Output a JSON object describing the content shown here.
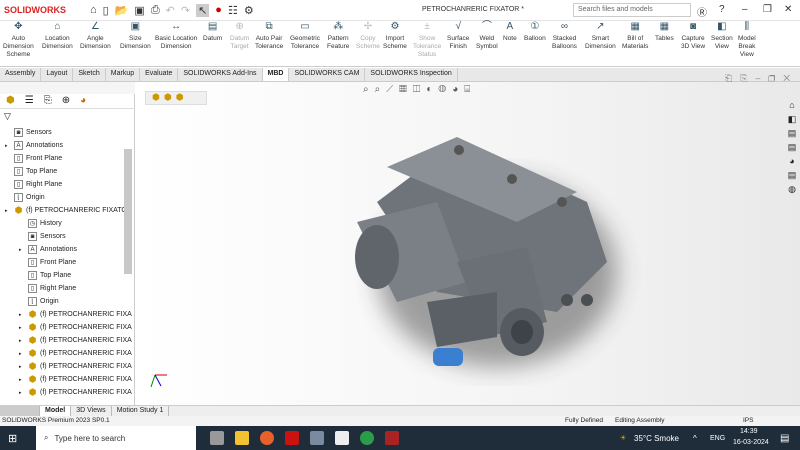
{
  "app": {
    "logo": "SOLIDWORKS",
    "title": "PETROCHANRERIC FIXATOR *",
    "search_placeholder": "Search files and models"
  },
  "ribbon": [
    {
      "label": "Auto\nDimension\nScheme",
      "icon": "✥",
      "enabled": true
    },
    {
      "label": "Location\nDimension",
      "icon": "⌂",
      "enabled": true
    },
    {
      "label": "Angle\nDimension",
      "icon": "∠",
      "enabled": true
    },
    {
      "label": "Size\nDimension",
      "icon": "▣",
      "enabled": true
    },
    {
      "label": "Basic Location\nDimension",
      "icon": "↔",
      "enabled": true
    },
    {
      "label": "Datum",
      "icon": "▤",
      "enabled": true
    },
    {
      "label": "Datum\nTarget",
      "icon": "⊕",
      "enabled": false
    },
    {
      "label": "Auto Pair\nTolerance",
      "icon": "⧉",
      "enabled": true
    },
    {
      "label": "Geometric\nTolerance",
      "icon": "▭",
      "enabled": true
    },
    {
      "label": "Pattern\nFeature",
      "icon": "⁂",
      "enabled": true
    },
    {
      "label": "Copy\nScheme",
      "icon": "✢",
      "enabled": false
    },
    {
      "label": "Import\nScheme",
      "icon": "⚙",
      "enabled": true
    },
    {
      "label": "Show\nTolerance\nStatus",
      "icon": "±",
      "enabled": false
    },
    {
      "label": "Surface\nFinish",
      "icon": "√",
      "enabled": true
    },
    {
      "label": "Weld\nSymbol",
      "icon": "⌒",
      "enabled": true
    },
    {
      "label": "Note",
      "icon": "A",
      "enabled": true
    },
    {
      "label": "Balloon",
      "icon": "①",
      "enabled": true
    },
    {
      "label": "Stacked\nBalloons",
      "icon": "∞",
      "enabled": true
    },
    {
      "label": "Smart\nDimension",
      "icon": "↗",
      "enabled": true
    },
    {
      "label": "Bill of\nMaterials",
      "icon": "▦",
      "enabled": true
    },
    {
      "label": "Tables",
      "icon": "▦",
      "enabled": true
    },
    {
      "label": "Capture\n3D View",
      "icon": "◙",
      "enabled": true
    },
    {
      "label": "Section\nView",
      "icon": "◧",
      "enabled": true
    },
    {
      "label": "Model\nBreak\nView",
      "icon": "⫼",
      "enabled": true
    }
  ],
  "tabs": [
    "Assembly",
    "Layout",
    "Sketch",
    "Markup",
    "Evaluate",
    "SOLIDWORKS Add-Ins",
    "MBD",
    "SOLIDWORKS CAM",
    "SOLIDWORKS Inspection"
  ],
  "active_tab": "MBD",
  "tree": [
    {
      "label": "Sensors",
      "icon": "sensor",
      "indent": 1,
      "expand": false
    },
    {
      "label": "Annotations",
      "icon": "A",
      "indent": 1,
      "expand": true
    },
    {
      "label": "Front Plane",
      "icon": "plane",
      "indent": 1,
      "expand": false
    },
    {
      "label": "Top Plane",
      "icon": "plane",
      "indent": 1,
      "expand": false
    },
    {
      "label": "Right Plane",
      "icon": "plane",
      "indent": 1,
      "expand": false
    },
    {
      "label": "Origin",
      "icon": "origin",
      "indent": 1,
      "expand": false
    },
    {
      "label": "(f) PETROCHANRERIC FIXATOR",
      "icon": "assembly",
      "indent": 1,
      "expand": true
    },
    {
      "label": "History",
      "icon": "history",
      "indent": 2,
      "expand": false
    },
    {
      "label": "Sensors",
      "icon": "sensor",
      "indent": 2,
      "expand": false
    },
    {
      "label": "Annotations",
      "icon": "A",
      "indent": 2,
      "expand": true
    },
    {
      "label": "Front Plane",
      "icon": "plane",
      "indent": 2,
      "expand": false
    },
    {
      "label": "Top Plane",
      "icon": "plane",
      "indent": 2,
      "expand": false
    },
    {
      "label": "Right Plane",
      "icon": "plane",
      "indent": 2,
      "expand": false
    },
    {
      "label": "Origin",
      "icon": "origin",
      "indent": 2,
      "expand": false
    },
    {
      "label": "(f) PETROCHANRERIC FIXA",
      "icon": "assembly",
      "indent": 2,
      "expand": true
    },
    {
      "label": "(f) PETROCHANRERIC FIXA",
      "icon": "assembly",
      "indent": 2,
      "expand": true
    },
    {
      "label": "(f) PETROCHANRERIC FIXA",
      "icon": "assembly",
      "indent": 2,
      "expand": true
    },
    {
      "label": "(f) PETROCHANRERIC FIXA",
      "icon": "assembly",
      "indent": 2,
      "expand": true
    },
    {
      "label": "(f) PETROCHANRERIC FIXA",
      "icon": "assembly",
      "indent": 2,
      "expand": true
    },
    {
      "label": "(f) PETROCHANRERIC FIXA",
      "icon": "assembly",
      "indent": 2,
      "expand": true
    },
    {
      "label": "(f) PETROCHANRERIC FIXA",
      "icon": "assembly",
      "indent": 2,
      "expand": true
    }
  ],
  "bottom_tabs": [
    "Model",
    "3D Views",
    "Motion Study 1"
  ],
  "status": {
    "version": "SOLIDWORKS Premium 2023 SP0.1",
    "defined": "Fully Defined",
    "mode": "Editing Assembly",
    "units": "IPS"
  },
  "taskbar": {
    "search": "Type here to search",
    "weather": "35°C  Smoke",
    "lang": "ENG",
    "time": "14:39",
    "date": "16-03-2024"
  }
}
